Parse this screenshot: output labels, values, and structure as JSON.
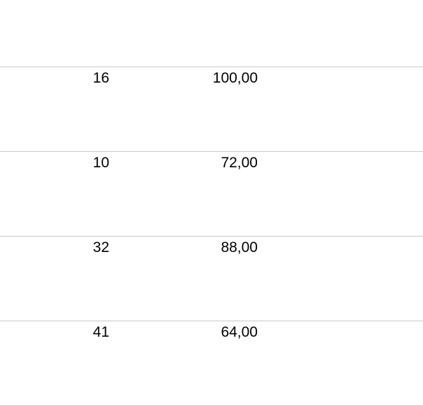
{
  "table": {
    "top_partial_glyph": ",",
    "rows": [
      {
        "qty": "16",
        "amount": "100,00"
      },
      {
        "qty": "10",
        "amount": "72,00"
      },
      {
        "qty": "32",
        "amount": "88,00"
      },
      {
        "qty": "41",
        "amount": "64,00"
      }
    ]
  }
}
